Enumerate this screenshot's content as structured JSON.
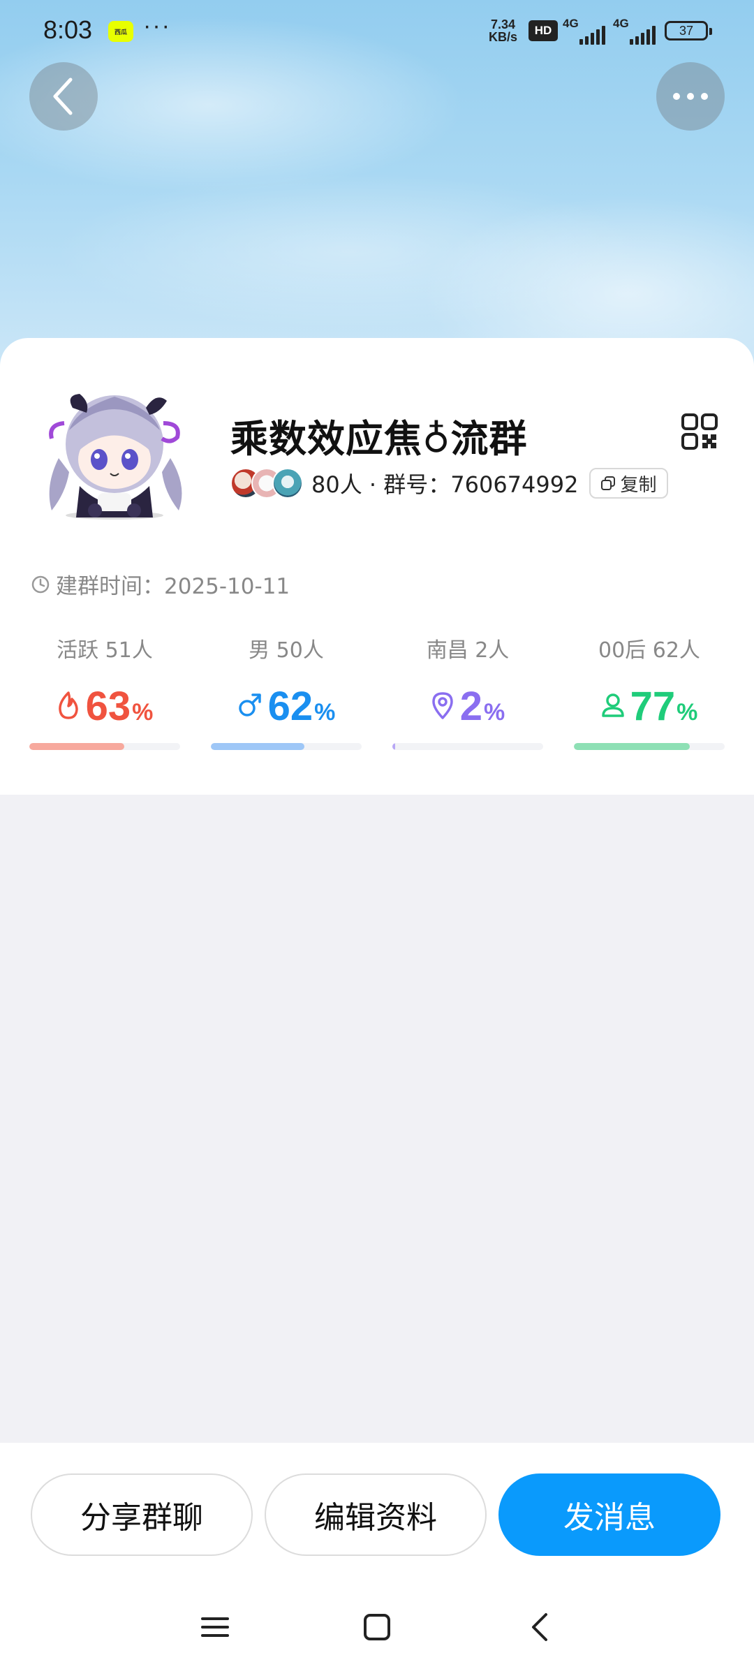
{
  "status_bar": {
    "time": "8:03",
    "badge_text": "西瓜",
    "overflow": "···",
    "net_speed_value": "7.34",
    "net_speed_unit": "KB/s",
    "hd": "HD",
    "sim1": "4G",
    "sim2": "4G",
    "battery": "37"
  },
  "header": {
    "back_icon": "chevron-left-icon",
    "more_icon": "more-dots-icon"
  },
  "group": {
    "name": "乘数效应焦♁流群",
    "member_count_text": "80人 · 群号：760674992",
    "copy_label": "复制",
    "created_text": "建群时间：2025-10-11"
  },
  "stats": [
    {
      "label": "活跃 51人",
      "value": "63",
      "unit": "%",
      "fraction": 0.63,
      "color": "#f0533f",
      "track_color": "#f7a99d",
      "icon": "flame-icon"
    },
    {
      "label": "男 50人",
      "value": "62",
      "unit": "%",
      "fraction": 0.62,
      "color": "#1a8ff0",
      "track_color": "#9ec7f7",
      "icon": "male-icon"
    },
    {
      "label": "南昌 2人",
      "value": "2",
      "unit": "%",
      "fraction": 0.02,
      "color": "#8a6ef0",
      "track_color": "#b8a8f5",
      "icon": "location-pin-icon"
    },
    {
      "label": "00后 62人",
      "value": "77",
      "unit": "%",
      "fraction": 0.77,
      "color": "#1fcc7a",
      "track_color": "#8ee0b5",
      "icon": "person-icon"
    }
  ],
  "actions": {
    "share": "分享群聊",
    "edit": "编辑资料",
    "send": "发消息"
  },
  "colors": {
    "primary": "#0a9afc",
    "page_bg": "#f1f1f5"
  }
}
